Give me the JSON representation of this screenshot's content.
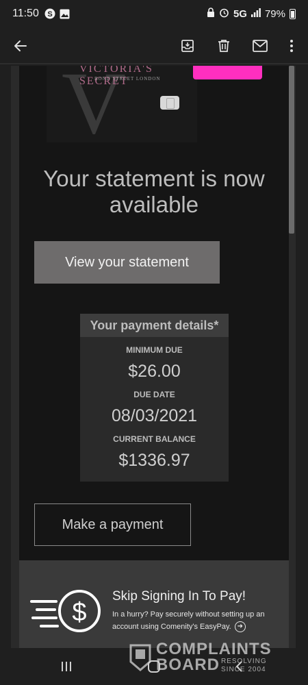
{
  "status_bar": {
    "time": "11:50",
    "left_icons": [
      "s-circle-icon",
      "image-icon"
    ],
    "right_icons": [
      "lock-icon",
      "alarm-icon",
      "signal-icon",
      "battery-icon"
    ],
    "network": "5G",
    "battery": "79%"
  },
  "toolbar": {
    "back_icon": "arrow-left-icon",
    "actions": [
      "archive-icon",
      "delete-icon",
      "mail-icon",
      "more-vert-icon"
    ]
  },
  "email": {
    "card": {
      "brand": "VICTORIA'S SECRET",
      "sub": "BOND STREET LONDON",
      "letter": "V"
    },
    "headline": "Your statement is now available",
    "view_button": "View your statement",
    "payment_details": {
      "title": "Your payment details*",
      "minimum_due_label": "MINIMUM DUE",
      "minimum_due": "$26.00",
      "due_date_label": "DUE DATE",
      "due_date": "08/03/2021",
      "current_balance_label": "CURRENT BALANCE",
      "current_balance": "$1336.97"
    },
    "pay_button": "Make a payment",
    "easypay": {
      "title": "Skip Signing In To Pay!",
      "text": "In a hurry? Pay securely without setting up an account using Comenity's EasyPay."
    }
  },
  "watermark": {
    "line1": "COMPLAINTS",
    "line2": "BOARD",
    "sub1": "RESOLVING",
    "sub2": "SINCE 2004"
  },
  "colors": {
    "background": "#1f1f1f",
    "email_bg": "#151515",
    "button_gray": "#6e6c6c",
    "accent_pink": "#ff2fbf"
  }
}
